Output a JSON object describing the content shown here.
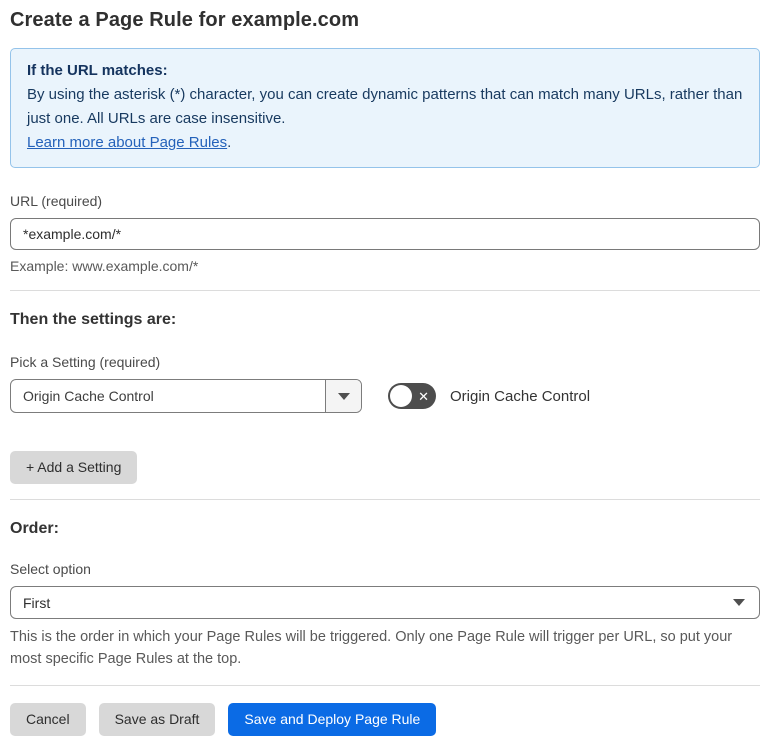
{
  "page": {
    "title": "Create a Page Rule for example.com"
  },
  "info_box": {
    "heading": "If the URL matches:",
    "body": "By using the asterisk (*) character, you can create dynamic patterns that can match many URLs, rather than just one. All URLs are case insensitive.",
    "link_label": "Learn more about Page Rules",
    "link_suffix": "."
  },
  "url_section": {
    "label": "URL (required)",
    "value": "*example.com/*",
    "example": "Example: www.example.com/*"
  },
  "settings_section": {
    "heading": "Then the settings are:",
    "picker_label": "Pick a Setting (required)",
    "picker_value": "Origin Cache Control",
    "toggle_label": "Origin Cache Control",
    "toggle_state": "off",
    "toggle_icon": "✕",
    "add_button_label": "+ Add a Setting"
  },
  "order_section": {
    "heading": "Order:",
    "select_label": "Select option",
    "select_value": "First",
    "help_text": "This is the order in which your Page Rules will be triggered. Only one Page Rule will trigger per URL, so put your most specific Page Rules at the top."
  },
  "footer": {
    "cancel_label": "Cancel",
    "save_draft_label": "Save as Draft",
    "save_deploy_label": "Save and Deploy Page Rule"
  },
  "colors": {
    "accent_blue": "#0B6BE5",
    "info_background": "#EAF4FC",
    "info_border": "#94C3EA",
    "info_text": "#17395F",
    "link_blue": "#2462BA",
    "toggle_off_background": "#4D4D4D",
    "button_gray": "#D8D8D8"
  }
}
